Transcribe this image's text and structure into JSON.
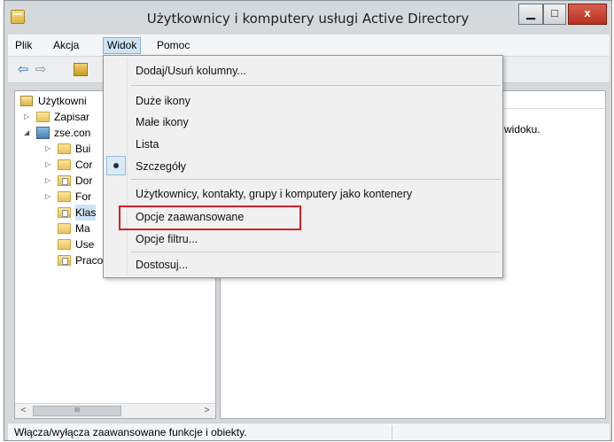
{
  "window": {
    "title": "Użytkownicy i komputery usługi Active Directory",
    "minimize_glyph": "▁",
    "maximize_glyph": "□",
    "close_glyph": "x"
  },
  "menubar": {
    "items": [
      {
        "label": "Plik"
      },
      {
        "label": "Akcja"
      },
      {
        "label": "Widok",
        "active": true
      },
      {
        "label": "Pomoc"
      }
    ]
  },
  "toolbar": {
    "back_icon": "arrow-left-icon",
    "forward_icon": "arrow-right-icon",
    "up_icon": "folder-up-icon",
    "back_glyph": "⇦",
    "forward_glyph": "⇨"
  },
  "tree": {
    "items": [
      {
        "label": "Użytkowni",
        "icon": "root-folder-icon",
        "expander": ""
      },
      {
        "label": "Zapisar",
        "icon": "folder-icon",
        "expander": "▷"
      },
      {
        "label": "zse.con",
        "icon": "domain-icon",
        "expander": "◢"
      },
      {
        "label": "Bui",
        "icon": "folder-icon",
        "expander": "▷"
      },
      {
        "label": "Cor",
        "icon": "folder-icon",
        "expander": "▷"
      },
      {
        "label": "Dor",
        "icon": "folder-doc-icon",
        "expander": "▷"
      },
      {
        "label": "For",
        "icon": "folder-icon",
        "expander": "▷"
      },
      {
        "label": "Klas",
        "icon": "folder-doc-icon",
        "expander": "",
        "selected": true
      },
      {
        "label": "Ma",
        "icon": "folder-icon",
        "expander": ""
      },
      {
        "label": "Use",
        "icon": "folder-icon",
        "expander": ""
      },
      {
        "label": "Pracownia",
        "icon": "folder-doc-icon",
        "expander": ""
      }
    ],
    "scroll_left": "<",
    "scroll_right": ">",
    "scroll_thumb": "III"
  },
  "right_pane": {
    "message": "widoku."
  },
  "dropdown": {
    "items": [
      {
        "label": "Dodaj/Usuń kolumny..."
      },
      {
        "label": "Duże ikony"
      },
      {
        "label": "Małe ikony"
      },
      {
        "label": "Lista"
      },
      {
        "label": "Szczegóły",
        "checked": true
      },
      {
        "label": "Użytkownicy, kontakty, grupy i komputery jako kontenery"
      },
      {
        "label": "Opcje zaawansowane",
        "highlighted": true
      },
      {
        "label": "Opcje filtru..."
      },
      {
        "label": "Dostosuj..."
      }
    ]
  },
  "statusbar": {
    "text": "Włącza/wyłącza zaawansowane funkcje i obiekty."
  },
  "colors": {
    "highlight_border": "#d22128",
    "menu_active": "#cde4f7",
    "close_button": "#c94a3a"
  }
}
